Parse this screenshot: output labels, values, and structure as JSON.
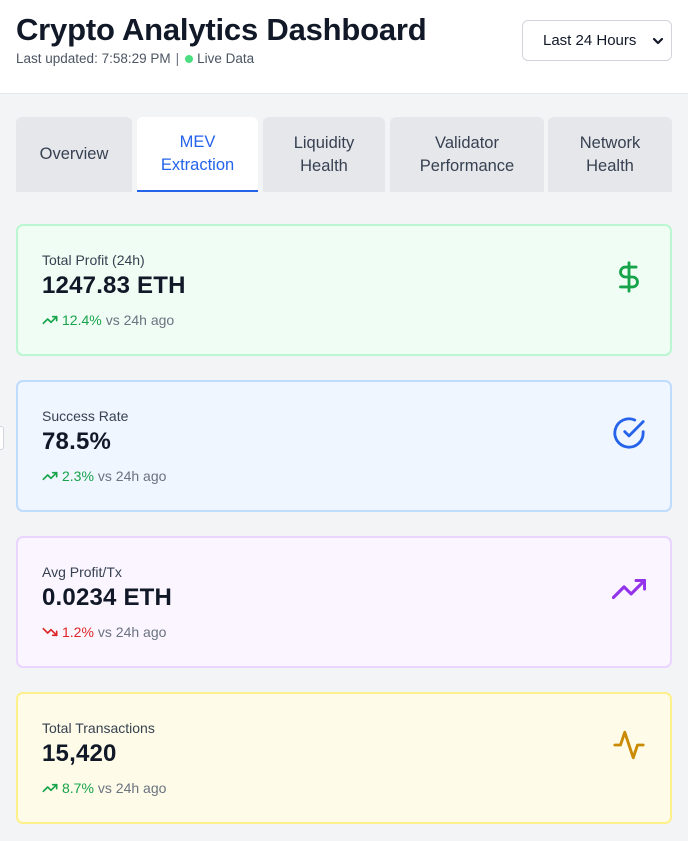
{
  "header": {
    "title": "Crypto Analytics Dashboard",
    "last_updated": "Last updated: 7:58:29 PM",
    "separator": "|",
    "live_label": "Live Data"
  },
  "time_range": {
    "selected": "Last 24 Hours"
  },
  "tabs": [
    {
      "line1": "Overview",
      "line2": ""
    },
    {
      "line1": "MEV",
      "line2": "Extraction"
    },
    {
      "line1": "Liquidity",
      "line2": "Health"
    },
    {
      "line1": "Validator",
      "line2": "Performance"
    },
    {
      "line1": "Network",
      "line2": "Health"
    }
  ],
  "active_tab": "MEV Extraction",
  "cards": [
    {
      "label": "Total Profit (24h)",
      "value": "1247.83 ETH",
      "change": "12.4%",
      "direction": "up",
      "suffix": "vs 24h ago",
      "icon": "dollar-icon",
      "bg": "#f0fdf4",
      "border": "#bbf7d0",
      "icon_color": "#16a34a"
    },
    {
      "label": "Success Rate",
      "value": "78.5%",
      "change": "2.3%",
      "direction": "up",
      "suffix": "vs 24h ago",
      "icon": "check-circle-icon",
      "bg": "#eff6ff",
      "border": "#bfdbfe",
      "icon_color": "#2563eb"
    },
    {
      "label": "Avg Profit/Tx",
      "value": "0.0234 ETH",
      "change": "1.2%",
      "direction": "down",
      "suffix": "vs 24h ago",
      "icon": "trending-up-icon",
      "bg": "#faf5ff",
      "border": "#e9d5ff",
      "icon_color": "#9333ea"
    },
    {
      "label": "Total Transactions",
      "value": "15,420",
      "change": "8.7%",
      "direction": "up",
      "suffix": "vs 24h ago",
      "icon": "activity-icon",
      "bg": "#fefce8",
      "border": "#fef08a",
      "icon_color": "#ca8a04"
    }
  ],
  "colors": {
    "up": "#16a34a",
    "down": "#dc2626",
    "accent": "#2563eb",
    "live": "#4ade80"
  }
}
